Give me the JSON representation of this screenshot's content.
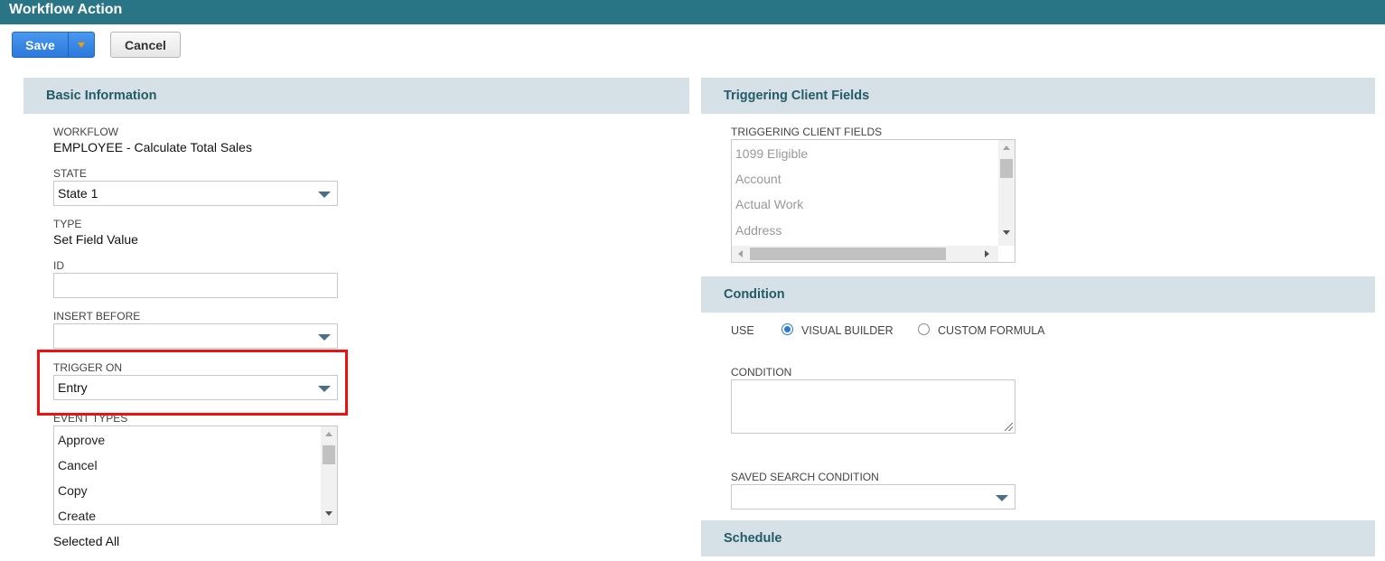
{
  "window": {
    "title": "Workflow Action"
  },
  "toolbar": {
    "save_label": "Save",
    "cancel_label": "Cancel"
  },
  "basic_information": {
    "header": "Basic Information",
    "workflow": {
      "label": "WORKFLOW",
      "value": "EMPLOYEE - Calculate Total Sales"
    },
    "state": {
      "label": "STATE",
      "value": "State 1"
    },
    "type": {
      "label": "TYPE",
      "value": "Set Field Value"
    },
    "id": {
      "label": "ID",
      "value": ""
    },
    "insert_before": {
      "label": "INSERT BEFORE",
      "value": ""
    },
    "trigger_on": {
      "label": "TRIGGER ON",
      "value": "Entry"
    },
    "event_types": {
      "label": "EVENT TYPES",
      "items": [
        "Approve",
        "Cancel",
        "Copy",
        "Create"
      ],
      "footer": "Selected All"
    }
  },
  "triggering_client_fields": {
    "header": "Triggering Client Fields",
    "label": "TRIGGERING CLIENT FIELDS",
    "items": [
      "1099 Eligible",
      "Account",
      "Actual Work",
      "Address"
    ]
  },
  "condition": {
    "header": "Condition",
    "use_label": "USE",
    "options": [
      {
        "label": "VISUAL BUILDER",
        "selected": true
      },
      {
        "label": "CUSTOM FORMULA",
        "selected": false
      }
    ],
    "condition_label": "CONDITION",
    "condition_value": "",
    "saved_search_label": "SAVED SEARCH CONDITION",
    "saved_search_value": ""
  },
  "schedule": {
    "header": "Schedule"
  },
  "colors": {
    "titlebar": "#2a7585",
    "section_header_bg": "#d5e1e6",
    "section_header_text": "#255a68",
    "save_button": "#2b78db",
    "highlight": "#ee1111"
  }
}
